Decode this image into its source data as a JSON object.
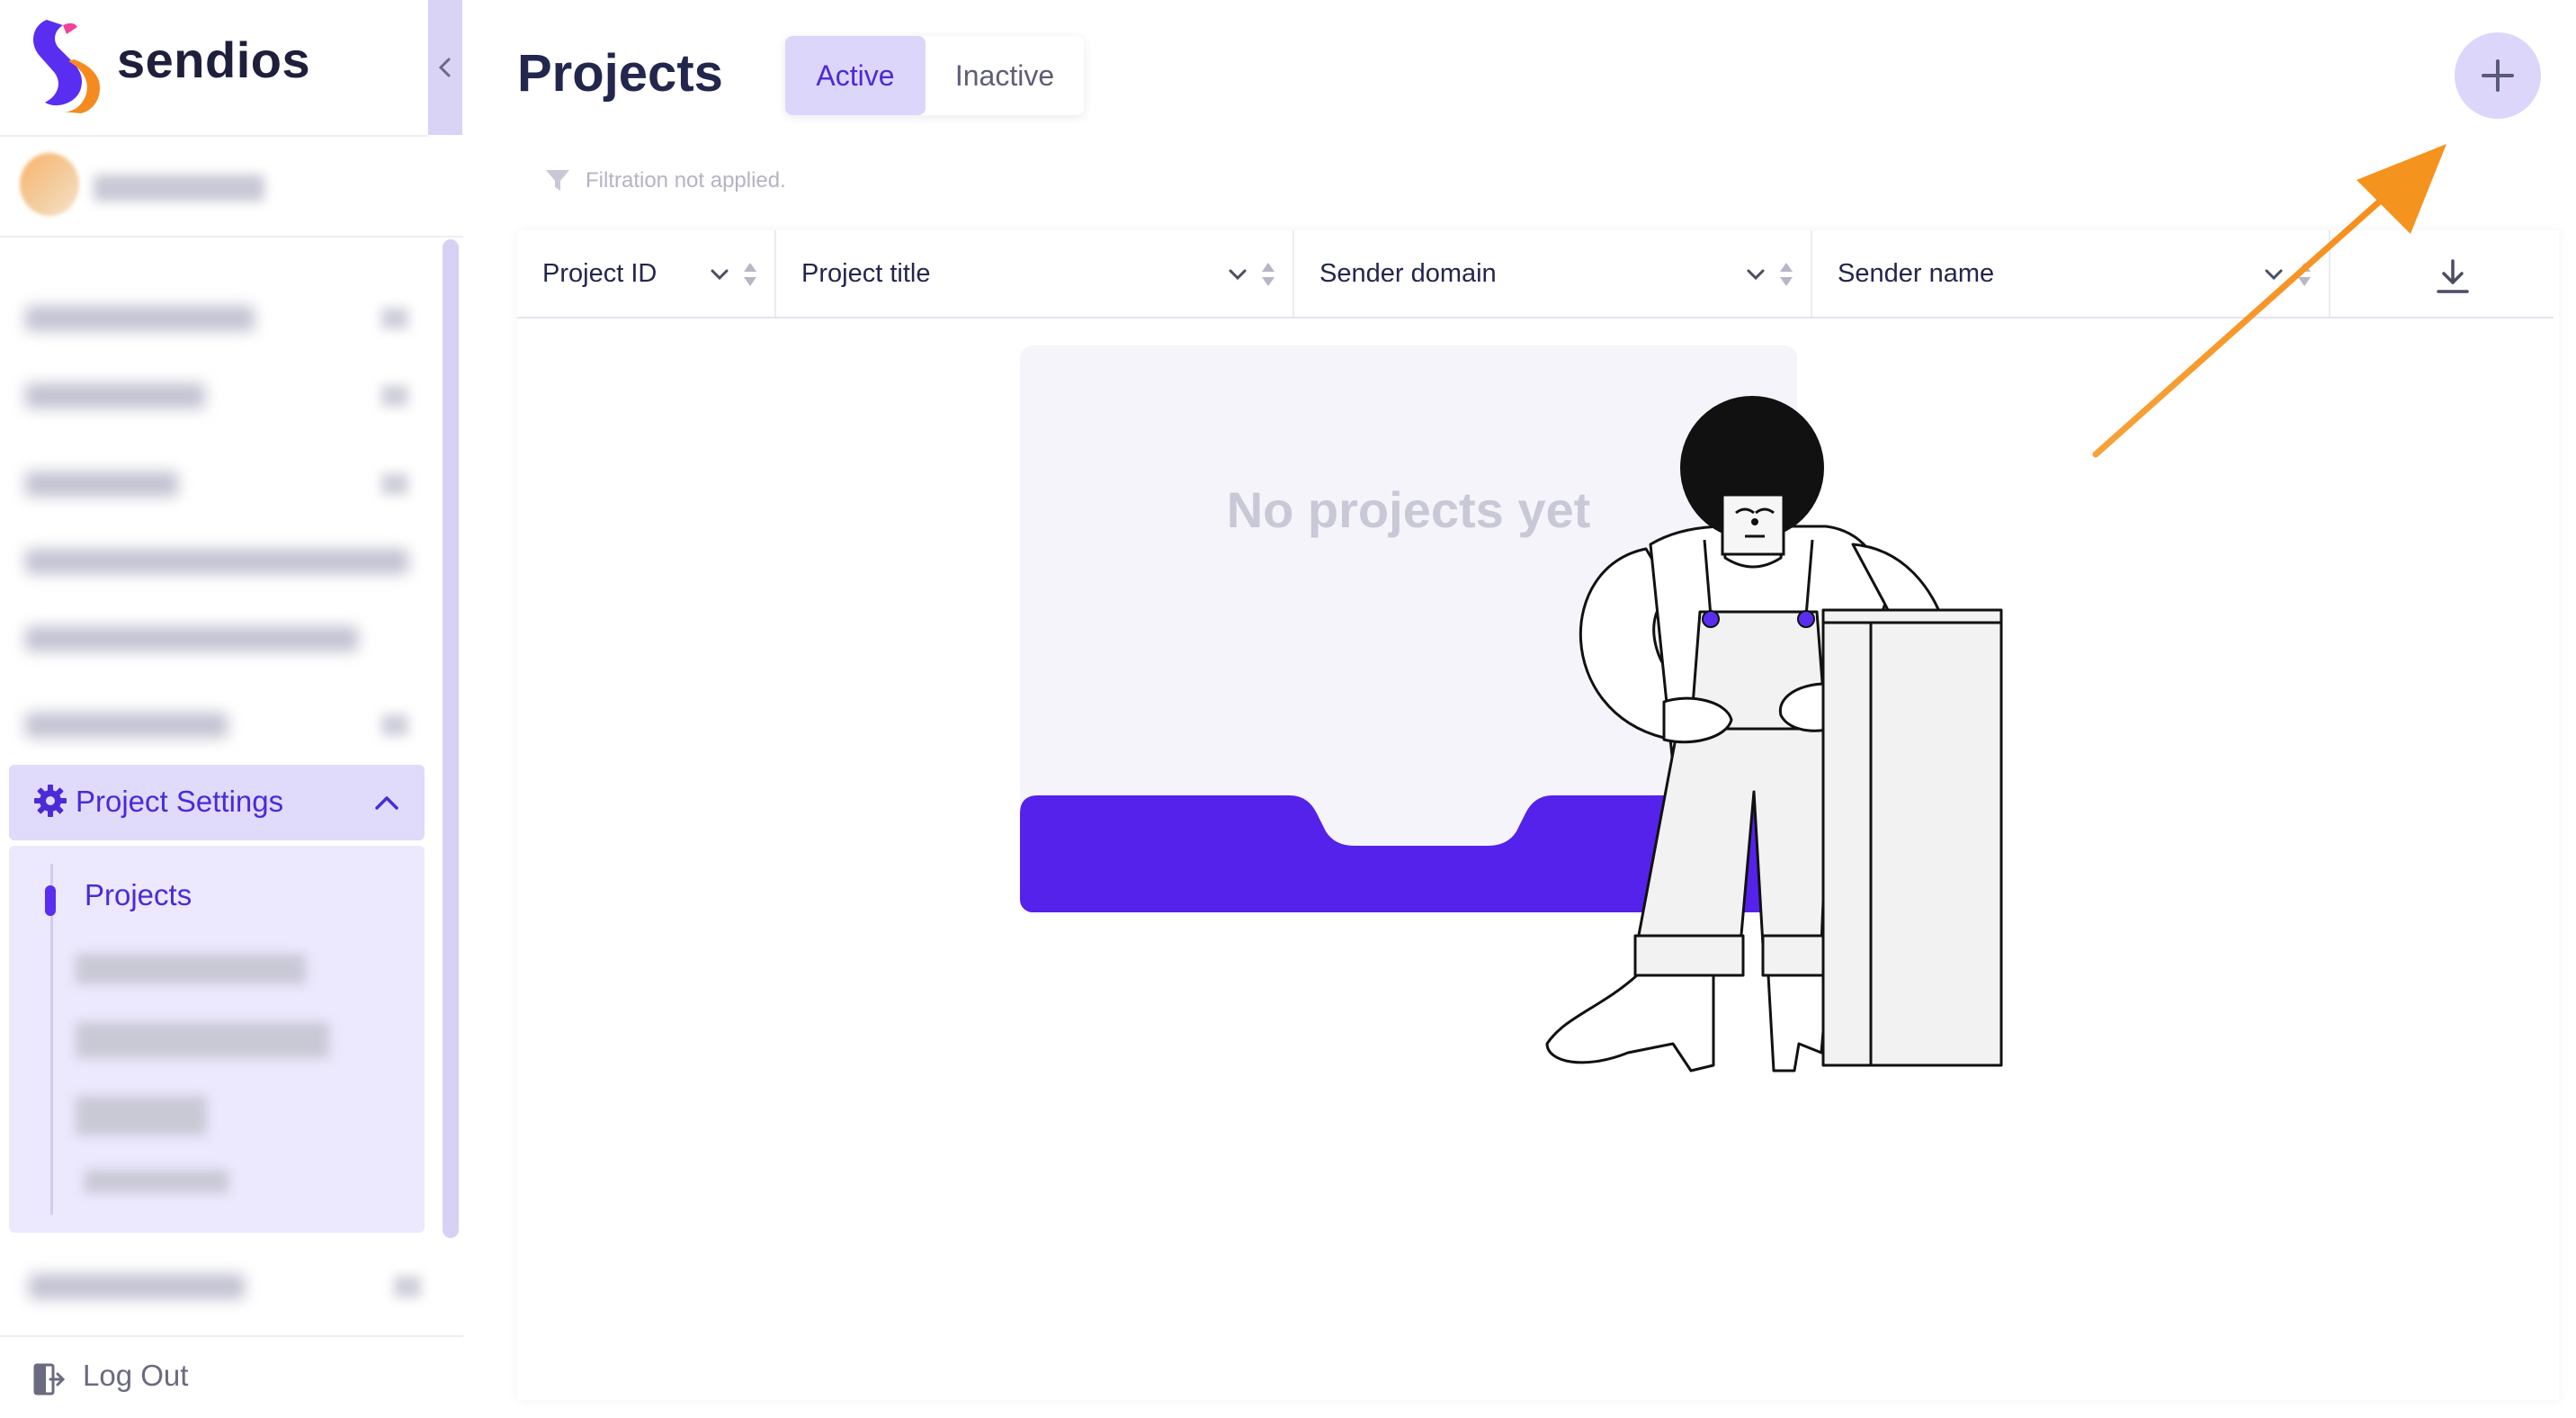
{
  "app": {
    "brand": "sendios"
  },
  "sidebar": {
    "section": {
      "label": "Project Settings",
      "items": [
        {
          "label": "Projects",
          "active": true
        }
      ]
    },
    "logout_label": "Log Out"
  },
  "header": {
    "title": "Projects",
    "tabs": [
      {
        "label": "Active",
        "selected": true
      },
      {
        "label": "Inactive",
        "selected": false
      }
    ]
  },
  "filter": {
    "text": "Filtration not applied."
  },
  "table": {
    "columns": [
      {
        "label": "Project ID"
      },
      {
        "label": "Project title"
      },
      {
        "label": "Sender domain"
      },
      {
        "label": "Sender name"
      }
    ]
  },
  "empty_state": {
    "title": "No projects yet"
  },
  "colors": {
    "accent": "#5a2ef0",
    "accent_soft": "#ddd6fb",
    "annotation_arrow": "#f5931f",
    "text_dark": "#23264d"
  },
  "icons": {
    "add": "plus-icon",
    "filter": "funnel-icon",
    "download": "download-icon",
    "collapse": "chevron-left-icon",
    "settings": "gear-icon",
    "logout": "logout-icon"
  }
}
